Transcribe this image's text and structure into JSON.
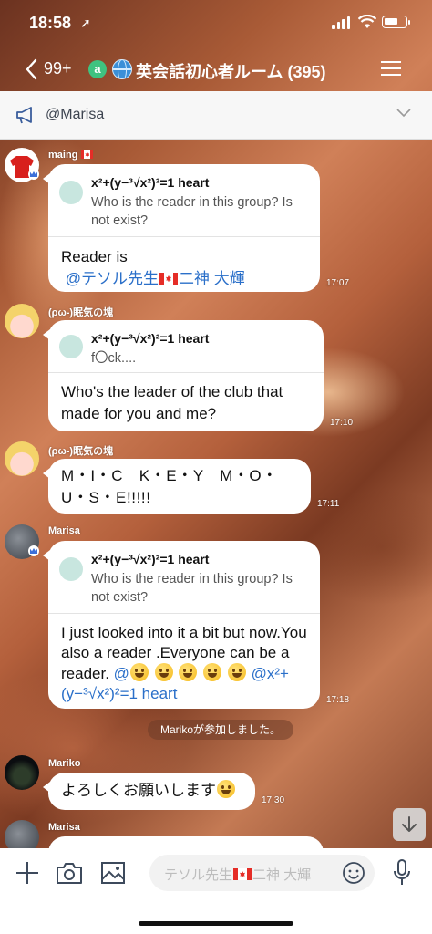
{
  "status_bar": {
    "time": "18:58",
    "location_glyph": "➚"
  },
  "header": {
    "back_count": "99+",
    "title": "英会話初心者ルーム (395)"
  },
  "announcement": {
    "text": "@Marisa"
  },
  "colors": {
    "mention": "#2a6fc9",
    "open_chat_green": "#3fc380"
  },
  "messages": [
    {
      "sender": "maing",
      "reply_name": "x²+(y−³√x²)²=1 heart",
      "reply_text": "Who is the reader in this group? Is not exist?",
      "text": "Reader is",
      "mention_name": "@テソル先生",
      "mention_name2": "二神 大輝",
      "time": "17:07"
    },
    {
      "sender": "(ρω-)眠気の塊",
      "reply_name": "x²+(y−³√x²)²=1 heart",
      "reply_text": "f〇ck....",
      "text": "Who's the leader of the club that made for you and me?",
      "time": "17:10"
    },
    {
      "sender": "(ρω-)眠気の塊",
      "text": "M・I・C　K・E・Y　M・O・U・S・E!!!!!",
      "time": "17:11"
    },
    {
      "sender": "Marisa",
      "reply_name": "x²+(y−³√x²)²=1 heart",
      "reply_text": "Who is the reader in this group? Is not exist?",
      "text": "I just looked into it a bit but now.You also a reader .Everyone can be a reader. ",
      "mention_at": "@",
      "mention_name": "@x²+(y−³√x²)²=1 heart",
      "time": "17:18"
    },
    {
      "sender": "Mariko",
      "text": "よろしくお願いします",
      "time": "17:30"
    },
    {
      "sender": "Marisa"
    }
  ],
  "system_message": "Marikoが参加しました。",
  "input": {
    "placeholder": "テソル先生",
    "placeholder_name": "二神 大輝"
  }
}
